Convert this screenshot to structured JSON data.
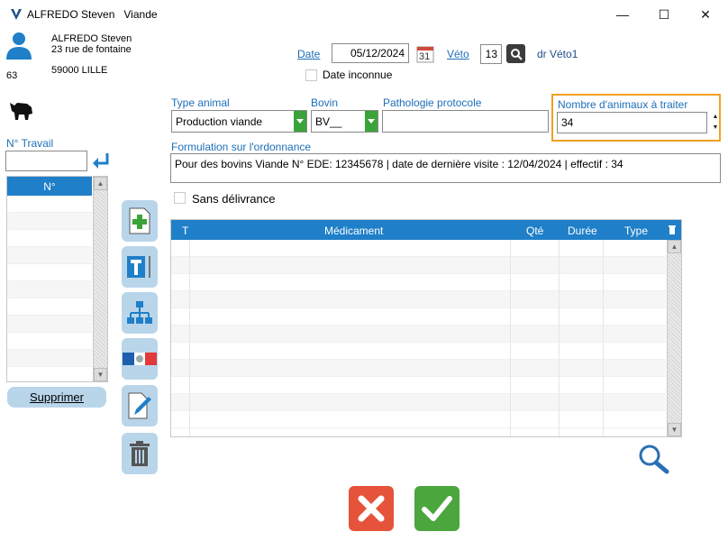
{
  "window": {
    "title_name": "ALFREDO Steven",
    "title_section": "Viande",
    "minimize": "—",
    "maximize": "☐",
    "close": "✕"
  },
  "client": {
    "name": "ALFREDO Steven",
    "address": "23 rue de fontaine",
    "city": "59000 LILLE",
    "number": "63"
  },
  "header": {
    "date_label": "Date",
    "date_value": "05/12/2024",
    "calendar_day": "31",
    "veto_label": "Véto",
    "veto_value": "13",
    "vet_name": "dr Véto1",
    "unknown_date_label": "Date inconnue"
  },
  "form": {
    "animal_type_label": "Type animal",
    "animal_type_value": "Production viande",
    "species_label": "Bovin",
    "species_value": "BV__",
    "pathology_label": "Pathologie protocole",
    "pathology_value": "",
    "count_label": "Nombre d'animaux à traiter",
    "count_value": "34",
    "formulation_label": "Formulation sur l'ordonnance",
    "formulation_value": "Pour des bovins Viande N° EDE: 12345678 | date de dernière visite : 12/04/2024 | effectif : 34",
    "no_delivery_label": "Sans délivrance"
  },
  "work": {
    "label": "N° Travail",
    "value": "",
    "column": "N°",
    "delete_button": "Supprimer"
  },
  "grid": {
    "columns": [
      "T",
      "Médicament",
      "Qté",
      "Durée",
      "Type"
    ]
  },
  "colors": {
    "accent_blue": "#1f7fc8",
    "highlight_orange": "#f0a020",
    "cancel_red": "#e5533a",
    "ok_green": "#4aa63d"
  }
}
